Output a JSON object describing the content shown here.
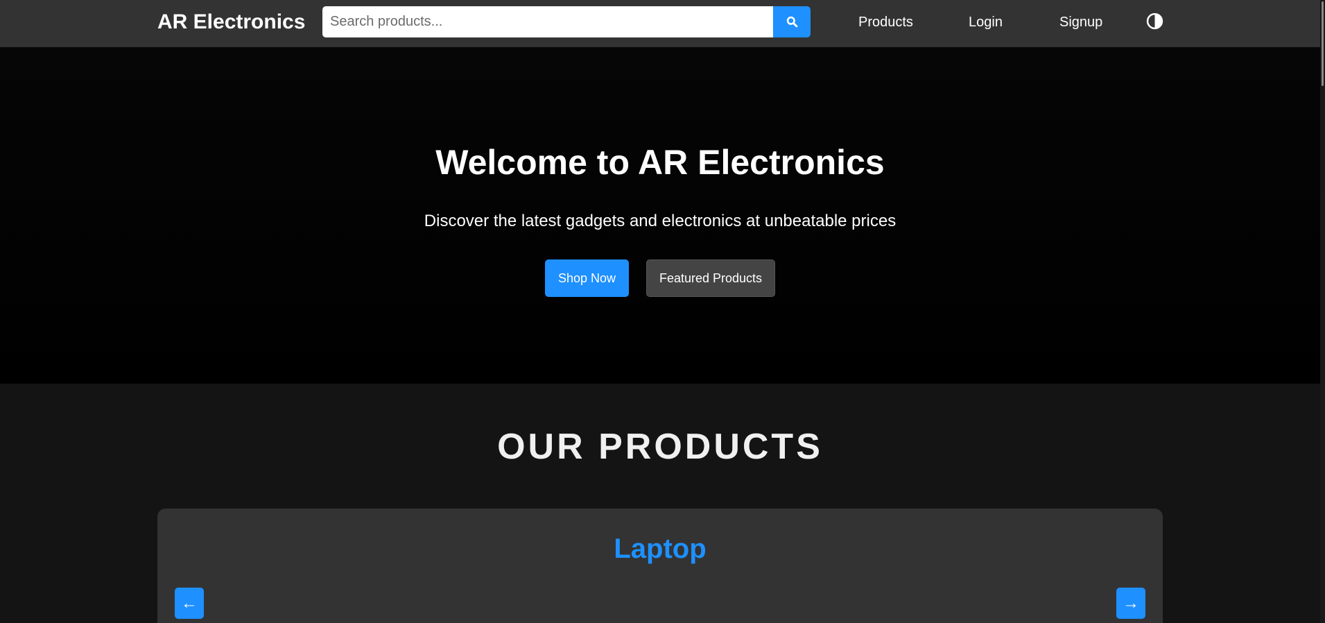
{
  "navbar": {
    "brand": "AR Electronics",
    "search_placeholder": "Search products...",
    "search_value": "",
    "links": {
      "products": "Products",
      "login": "Login",
      "signup": "Signup"
    },
    "search_icon": "search-icon",
    "theme_icon": "contrast-icon"
  },
  "hero": {
    "title": "Welcome to AR Electronics",
    "subtitle": "Discover the latest gadgets and electronics at unbeatable prices",
    "shop_label": "Shop Now",
    "featured_label": "Featured Products"
  },
  "products": {
    "section_title": "OUR PRODUCTS",
    "current_category": "Laptop",
    "prev_arrow": "←",
    "next_arrow": "→"
  },
  "colors": {
    "accent": "#1e90ff",
    "navbar_bg": "#333333",
    "hero_bg": "#000000",
    "section_bg": "#141414",
    "card_bg": "#333333",
    "secondary_button": "#444444"
  }
}
